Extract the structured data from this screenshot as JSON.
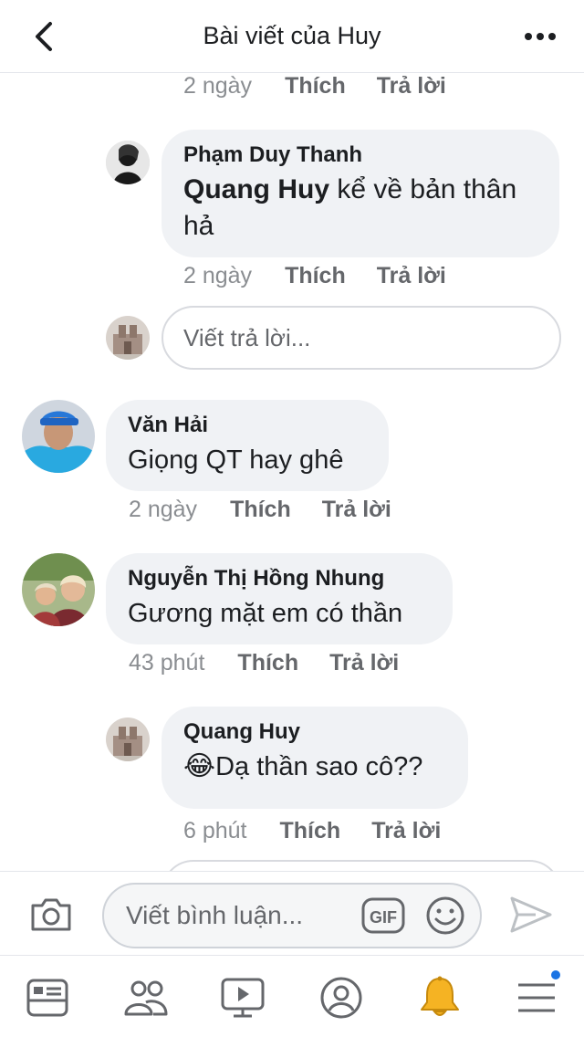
{
  "header": {
    "title": "Bài viết của Huy",
    "back_icon": "chevron-left-icon",
    "more_icon": "more-horizontal-icon"
  },
  "comments": [
    {
      "id": "c0",
      "time": "2 ngày",
      "like": "Thích",
      "reply": "Trả lời"
    },
    {
      "id": "c1",
      "author": "Phạm Duy Thanh",
      "mention": "Quang Huy",
      "text_line1": " kể về bản thân",
      "text_line2": "hả",
      "time": "2 ngày",
      "like": "Thích",
      "reply": "Trả lời"
    },
    {
      "id": "c2",
      "author": "Văn Hải",
      "text": "Giọng QT hay ghê",
      "time": "2 ngày",
      "like": "Thích",
      "reply": "Trả lời"
    },
    {
      "id": "c3",
      "author": "Nguyễn Thị Hồng Nhung",
      "text": "Gương mặt em có thần",
      "time": "43 phút",
      "like": "Thích",
      "reply": "Trả lời"
    },
    {
      "id": "c4",
      "author": "Quang Huy",
      "emoji": "😂",
      "text": "Dạ thần sao cô??",
      "time": "6 phút",
      "like": "Thích",
      "reply": "Trả lời"
    }
  ],
  "reply_input": {
    "placeholder": "Viết trả lời..."
  },
  "composer": {
    "placeholder": "Viết bình luận...",
    "gif_label": "GIF"
  },
  "tabs": [
    "news-feed-icon",
    "groups-icon",
    "watch-icon",
    "profile-icon",
    "notifications-icon",
    "menu-icon"
  ],
  "colors": {
    "accent": "#1b74e4",
    "bubble": "#f0f2f5",
    "bell": "#f5b323"
  }
}
